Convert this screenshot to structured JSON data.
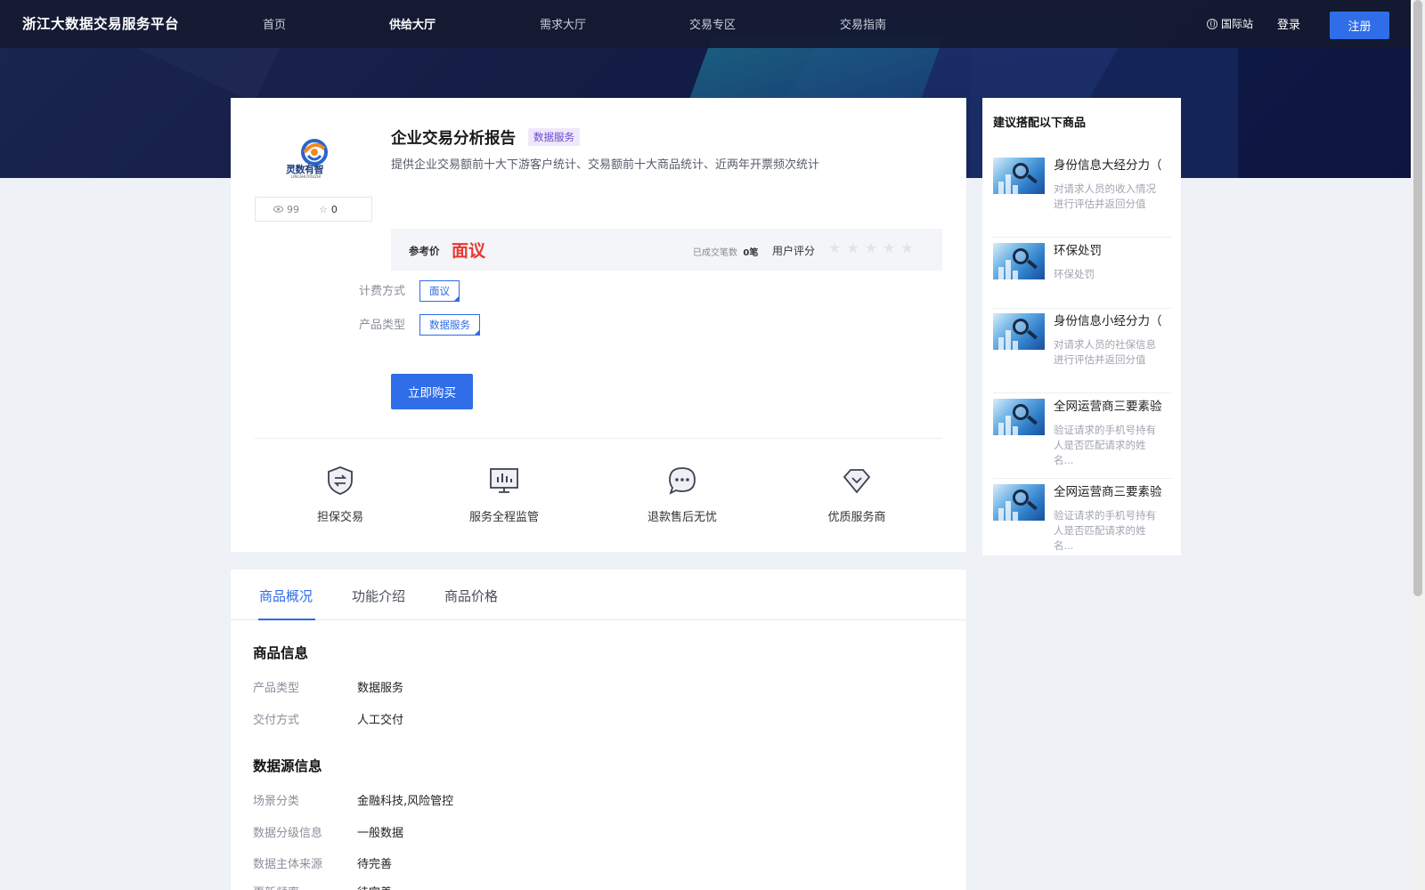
{
  "header": {
    "brand": "浙江大数据交易服务平台",
    "nav": [
      "首页",
      "供给大厅",
      "需求大厅",
      "交易专区",
      "交易指南"
    ],
    "active_nav": "供给大厅",
    "intl": "国际站",
    "login": "登录",
    "register": "注册"
  },
  "product": {
    "logo_text": "灵数有智",
    "logo_sub": "LINGSHUYOUZHI",
    "views": "99",
    "favorites": "0",
    "title": "企业交易分析报告",
    "tag": "数据服务",
    "description": "提供企业交易额前十大下游客户统计、交易额前十大商品统计、近两年开票频次统计",
    "price_label": "参考价",
    "price_value": "面议",
    "deal_label": "已成交笔数",
    "deal_count": "0笔",
    "rating_label": "用户评分",
    "stars": "★★★★★",
    "billing_label": "计费方式",
    "billing_value": "面议",
    "type_label": "产品类型",
    "type_value": "数据服务",
    "buy_button": "立即购买"
  },
  "features": [
    {
      "icon": "shield-exchange-icon",
      "label": "担保交易"
    },
    {
      "icon": "monitor-chart-icon",
      "label": "服务全程监管"
    },
    {
      "icon": "chat-bubble-icon",
      "label": "退款售后无忧"
    },
    {
      "icon": "diamond-icon",
      "label": "优质服务商"
    }
  ],
  "tabs": [
    "商品概况",
    "功能介绍",
    "商品价格"
  ],
  "active_tab": "商品概况",
  "info": {
    "section1_title": "商品信息",
    "section1": [
      {
        "k": "产品类型",
        "v": "数据服务"
      },
      {
        "k": "交付方式",
        "v": "人工交付"
      }
    ],
    "section2_title": "数据源信息",
    "section2": [
      {
        "k": "场景分类",
        "v": "金融科技,风险管控"
      },
      {
        "k": "数据分级信息",
        "v": "一般数据"
      },
      {
        "k": "数据主体来源",
        "v": "待完善"
      },
      {
        "k": "更新频率",
        "v": "待完善"
      }
    ]
  },
  "sidebar": {
    "title": "建议搭配以下商品",
    "items": [
      {
        "name": "身份信息大经分力（",
        "desc": "对请求人员的收入情况进行评估并返回分值"
      },
      {
        "name": "环保处罚",
        "desc": "环保处罚"
      },
      {
        "name": "身份信息小经分力（",
        "desc": "对请求人员的社保信息进行评估并返回分值"
      },
      {
        "name": "全网运营商三要素验",
        "desc": "验证请求的手机号持有人是否匹配请求的姓名..."
      },
      {
        "name": "全网运营商三要素验",
        "desc": "验证请求的手机号持有人是否匹配请求的姓名..."
      }
    ]
  },
  "colors": {
    "primary": "#2f6ee8",
    "price": "#e8372f",
    "tag_bg": "#efe8fb",
    "tag_fg": "#6a4ad1"
  }
}
